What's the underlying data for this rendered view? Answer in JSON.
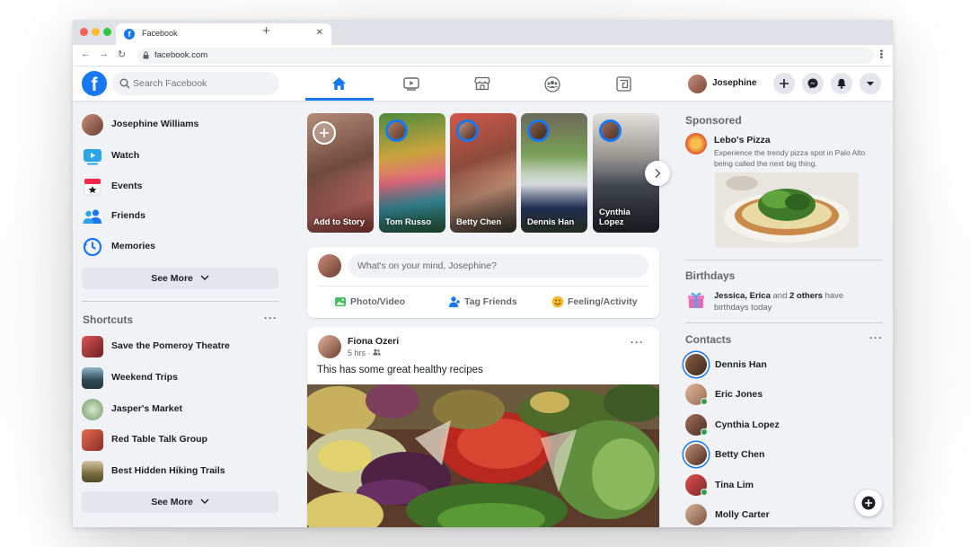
{
  "browser": {
    "tab_title": "Facebook",
    "url": "facebook.com"
  },
  "header": {
    "logo": "f",
    "search_placeholder": "Search Facebook",
    "nav_tabs": [
      {
        "name": "home",
        "icon": "home-icon",
        "active": true
      },
      {
        "name": "watch",
        "icon": "video-icon",
        "active": false
      },
      {
        "name": "marketplace",
        "icon": "store-icon",
        "active": false
      },
      {
        "name": "groups",
        "icon": "groups-icon",
        "active": false
      },
      {
        "name": "gaming",
        "icon": "gaming-icon",
        "active": false
      }
    ],
    "profile_name": "Josephine",
    "action_icons": [
      "plus-icon",
      "messenger-icon",
      "bell-icon",
      "caret-down-icon"
    ],
    "accent_color": "#1877f2"
  },
  "left_nav": {
    "items": [
      {
        "label": "Josephine Williams",
        "icon": "profile-avatar"
      },
      {
        "label": "Watch",
        "icon": "watch-icon"
      },
      {
        "label": "Events",
        "icon": "events-icon"
      },
      {
        "label": "Friends",
        "icon": "friends-icon"
      },
      {
        "label": "Memories",
        "icon": "memories-icon"
      }
    ],
    "see_more": "See More",
    "shortcuts_title": "Shortcuts",
    "shortcuts": [
      {
        "label": "Save the Pomeroy Theatre"
      },
      {
        "label": "Weekend Trips"
      },
      {
        "label": "Jasper's Market"
      },
      {
        "label": "Red Table Talk Group"
      },
      {
        "label": "Best Hidden Hiking Trails"
      }
    ],
    "shortcuts_see_more": "See More"
  },
  "stories": [
    {
      "label": "Add to Story"
    },
    {
      "label": "Tom Russo"
    },
    {
      "label": "Betty Chen"
    },
    {
      "label": "Dennis Han"
    },
    {
      "label": "Cynthia Lopez"
    }
  ],
  "composer": {
    "placeholder": "What's on your mind, Josephine?",
    "actions": [
      {
        "label": "Photo/Video",
        "icon": "photo-icon"
      },
      {
        "label": "Tag Friends",
        "icon": "tag-friends-icon"
      },
      {
        "label": "Feeling/Activity",
        "icon": "feeling-icon"
      }
    ]
  },
  "post": {
    "author": "Fiona Ozeri",
    "time": "5 hrs",
    "text": "This has some great healthy recipes"
  },
  "right": {
    "sponsored_title": "Sponsored",
    "ad_name": "Lebo's Pizza",
    "ad_text": "Experience the trendy pizza spot in Palo Alto being called the next big thing.",
    "birthdays_title": "Birthdays",
    "birthday_names": "Jessica, Erica",
    "birthday_and": " and ",
    "birthday_others": "2 others",
    "birthday_rest": " have birthdays today",
    "contacts_title": "Contacts",
    "contacts": [
      {
        "name": "Dennis Han",
        "online": false,
        "story": true
      },
      {
        "name": "Eric Jones",
        "online": true,
        "story": false
      },
      {
        "name": "Cynthia Lopez",
        "online": true,
        "story": false
      },
      {
        "name": "Betty Chen",
        "online": false,
        "story": true
      },
      {
        "name": "Tina Lim",
        "online": true,
        "story": false
      },
      {
        "name": "Molly Carter",
        "online": false,
        "story": false
      }
    ]
  }
}
